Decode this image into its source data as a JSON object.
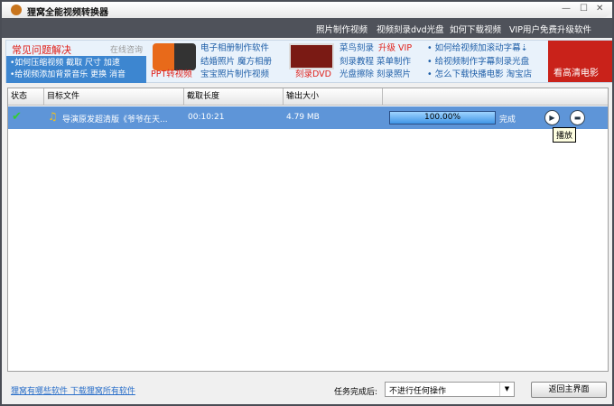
{
  "window": {
    "title": "狸窝全能视频转换器"
  },
  "nav": [
    "照片制作视频",
    "视频刻录dvd光盘",
    "如何下载视频",
    "VIP用户免费升级软件"
  ],
  "banner": {
    "faq_title": "常见问题解决",
    "online": "在线咨询",
    "faq_line1": "•如何压缩视频  截取  尺寸  加速",
    "faq_line2": "•给视频添加背景音乐  更换  消音",
    "ppt_label": "PPT转视频",
    "album_links": [
      "电子相册制作软件",
      "结婚照片  魔方相册",
      "宝宝照片制作视频"
    ],
    "dvd_label": "刻录DVD",
    "burn_line1": "菜鸟刻录",
    "upgrade": "升级 VIP",
    "burn_line2": "刻录教程  菜单制作",
    "burn_line3": "光盘擦除  刻录照片",
    "tips": [
      "• 如何给视频加滚动字幕⇣",
      "• 给视频制作字幕刻录光盘",
      "• 怎么下载快播电影  淘宝店"
    ],
    "hd_label": "看高清电影"
  },
  "table": {
    "headers": [
      "状态",
      "目标文件",
      "截取长度",
      "输出大小",
      ""
    ],
    "rows": [
      {
        "file": "导演原发超清版《爷爷在天...",
        "length": "00:10:21",
        "size": "4.79 MB",
        "progress": "100.00%",
        "progress_value": 100,
        "status": "完成"
      }
    ]
  },
  "tooltip": "播放",
  "footer": {
    "link": "狸窝有哪些软件 下载狸窝所有软件",
    "after_label": "任务完成后:",
    "after_value": "不进行任何操作",
    "back": "返回主界面"
  }
}
